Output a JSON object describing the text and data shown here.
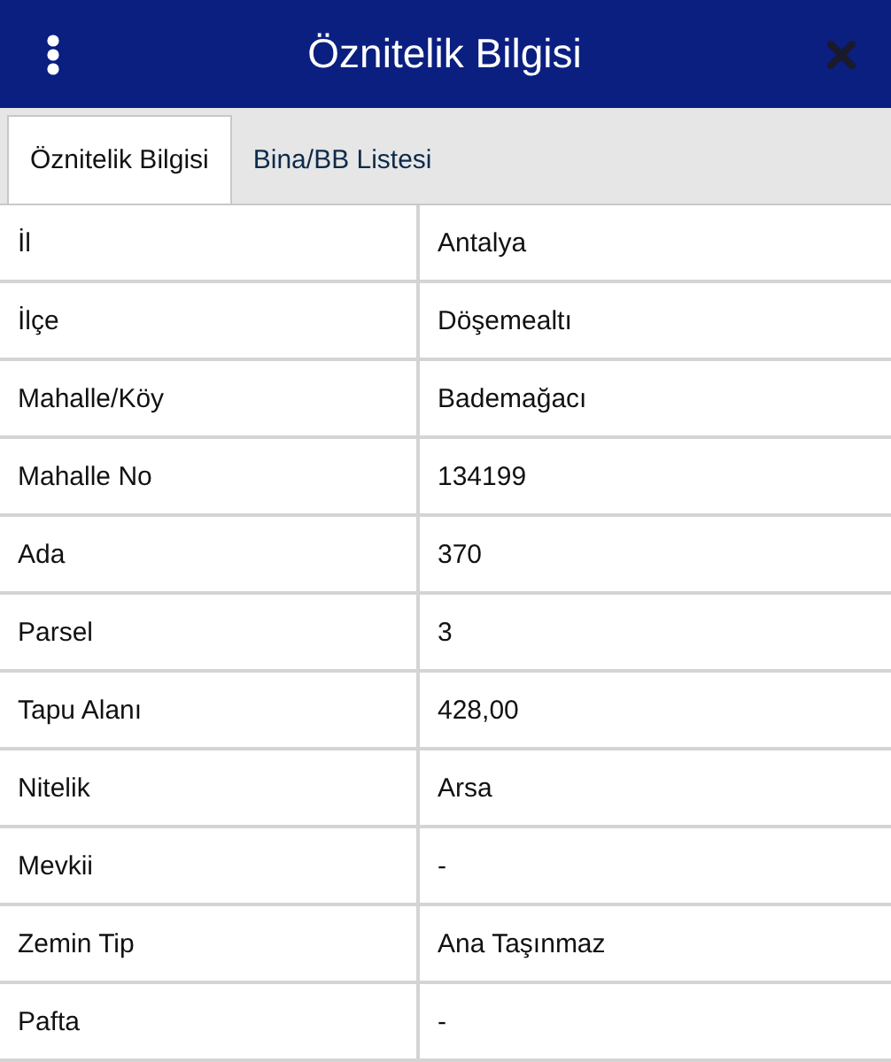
{
  "header": {
    "title": "Öznitelik Bilgisi"
  },
  "tabs": [
    {
      "label": "Öznitelik Bilgisi",
      "selected": true
    },
    {
      "label": "Bina/BB Listesi",
      "selected": false
    }
  ],
  "rows": [
    {
      "label": "İl",
      "value": "Antalya"
    },
    {
      "label": "İlçe",
      "value": "Döşemealtı"
    },
    {
      "label": "Mahalle/Köy",
      "value": "Bademağacı"
    },
    {
      "label": "Mahalle No",
      "value": "134199"
    },
    {
      "label": "Ada",
      "value": "370"
    },
    {
      "label": "Parsel",
      "value": "3"
    },
    {
      "label": "Tapu Alanı",
      "value": "428,00"
    },
    {
      "label": "Nitelik",
      "value": "Arsa"
    },
    {
      "label": "Mevkii",
      "value": "-"
    },
    {
      "label": "Zemin Tip",
      "value": "Ana Taşınmaz"
    },
    {
      "label": "Pafta",
      "value": "-"
    }
  ]
}
